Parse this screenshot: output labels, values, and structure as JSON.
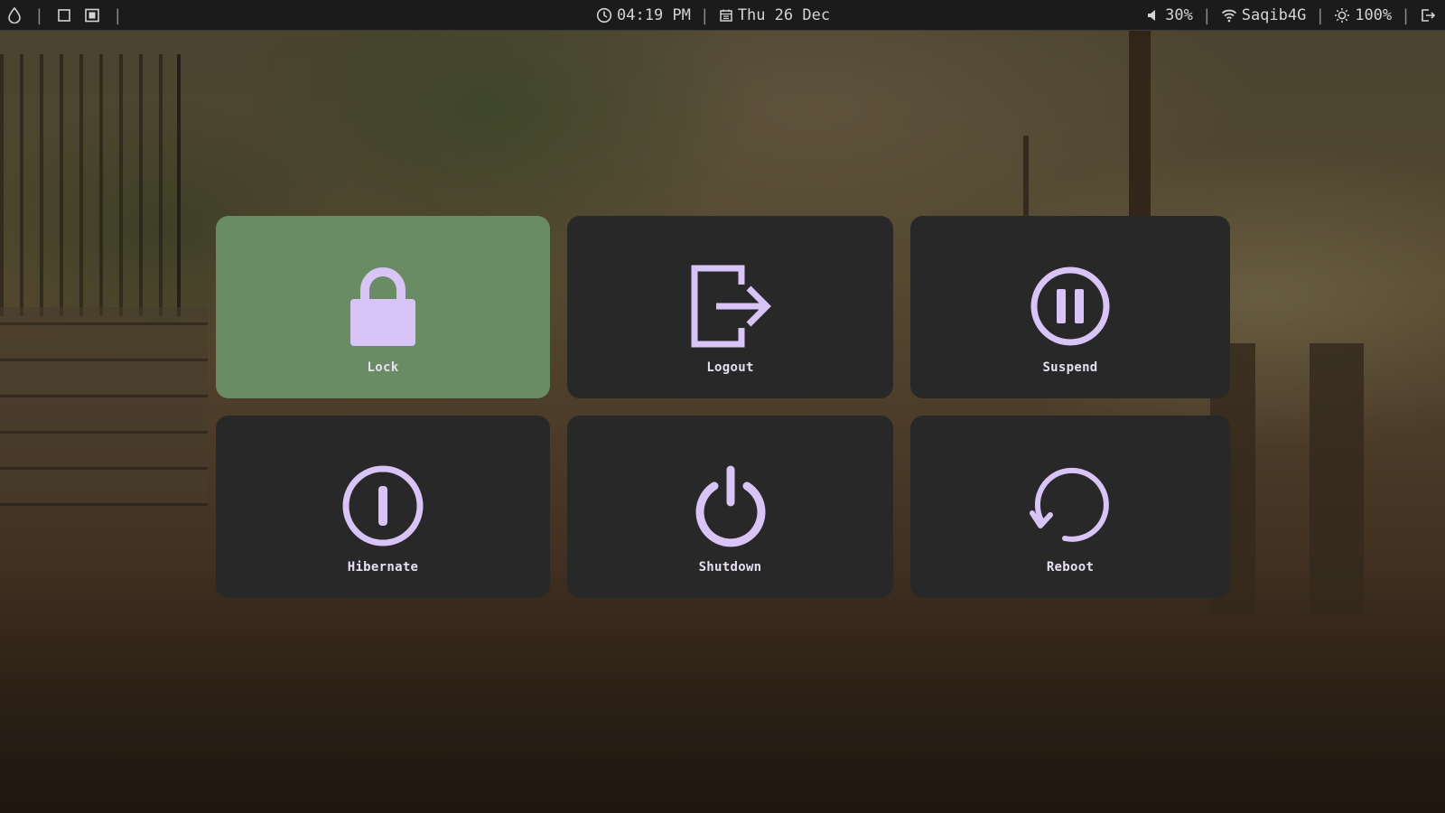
{
  "topbar": {
    "left": {
      "icons": [
        "droplet-icon",
        "window-outline-icon",
        "window-filled-icon"
      ]
    },
    "clock": {
      "time": "04:19 PM",
      "icon": "clock-icon"
    },
    "calendar": {
      "date": "Thu 26 Dec",
      "icon": "calendar-icon"
    },
    "volume": {
      "value": "30%",
      "icon": "speaker-icon"
    },
    "wifi": {
      "ssid": "Saqib4G",
      "icon": "wifi-icon"
    },
    "brightness": {
      "value": "100%",
      "icon": "sun-icon"
    },
    "exit": {
      "icon": "exit-icon"
    }
  },
  "menu": {
    "accent_color": "#6a8c64",
    "tile_color": "#282828",
    "icon_color": "#d8c4f6",
    "items": [
      {
        "label": "Lock",
        "icon": "lock-icon",
        "selected": true
      },
      {
        "label": "Logout",
        "icon": "logout-icon",
        "selected": false
      },
      {
        "label": "Suspend",
        "icon": "pause-icon",
        "selected": false
      },
      {
        "label": "Hibernate",
        "icon": "hibernate-icon",
        "selected": false
      },
      {
        "label": "Shutdown",
        "icon": "power-icon",
        "selected": false
      },
      {
        "label": "Reboot",
        "icon": "reboot-icon",
        "selected": false
      }
    ]
  }
}
